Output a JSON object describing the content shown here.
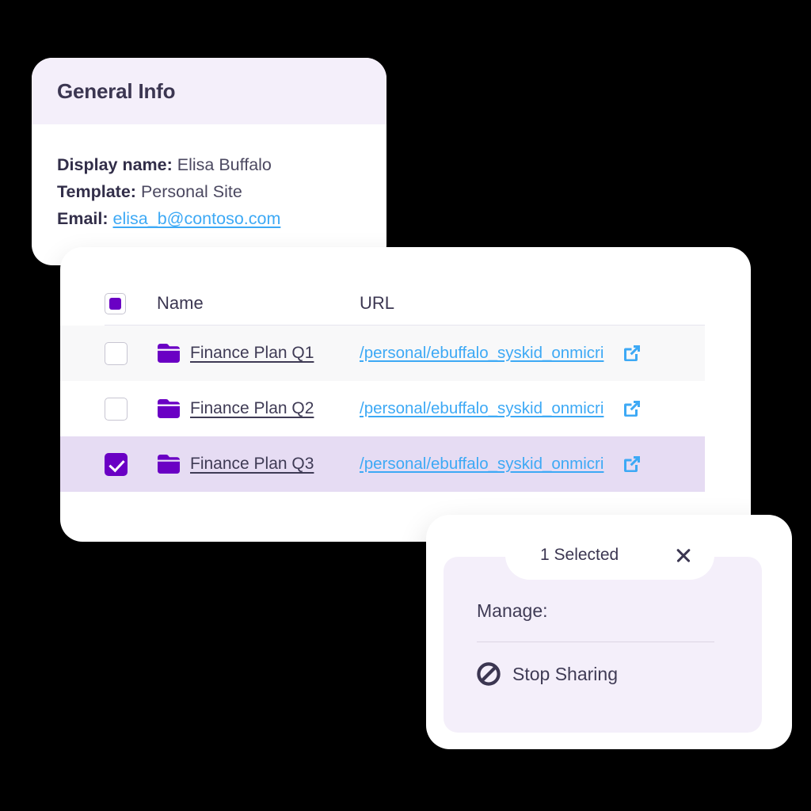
{
  "info_card": {
    "title": "General Info",
    "fields": [
      {
        "label": "Display name:",
        "value": "Elisa Buffalo",
        "is_link": false
      },
      {
        "label": "Template:",
        "value": "Personal Site",
        "is_link": false
      },
      {
        "label": "Email:",
        "value": "elisa_b@contoso.com",
        "is_link": true
      }
    ]
  },
  "table": {
    "columns": [
      "Name",
      "URL"
    ],
    "header_checkbox_state": "indeterminate",
    "rows": [
      {
        "checked": false,
        "icon": "folder-icon",
        "name": "Finance Plan Q1",
        "url": "/personal/ebuffalo_syskid_onmicri",
        "open_icon": "external-link-icon"
      },
      {
        "checked": false,
        "icon": "folder-icon",
        "name": "Finance Plan Q2",
        "url": "/personal/ebuffalo_syskid_onmicri",
        "open_icon": "external-link-icon"
      },
      {
        "checked": true,
        "icon": "folder-icon",
        "name": "Finance Plan Q3",
        "url": "/personal/ebuffalo_syskid_onmicri",
        "open_icon": "external-link-icon"
      }
    ]
  },
  "manage_panel": {
    "selected_text": "1 Selected",
    "close_icon": "close-icon",
    "manage_label": "Manage:",
    "actions": [
      {
        "icon": "no-entry-icon",
        "label": "Stop Sharing"
      }
    ]
  },
  "colors": {
    "background": "#000000",
    "accent_purple": "#6a00c4",
    "link_blue": "#3da9f5",
    "text_dark": "#3b3651",
    "lavender_panel": "#f4effa",
    "selected_row": "#e6dcf3",
    "alt_row": "#f8f8f9"
  }
}
